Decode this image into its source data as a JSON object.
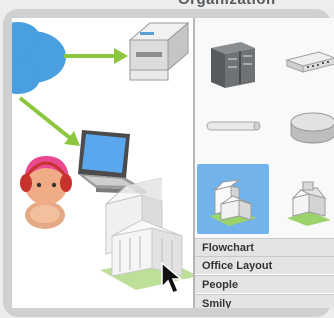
{
  "header": {
    "title": "Organization"
  },
  "palette": {
    "items": [
      {
        "name": "server-rack-icon",
        "selected": false
      },
      {
        "name": "network-switch-icon",
        "selected": false
      },
      {
        "name": "cable-bar-icon",
        "selected": false
      },
      {
        "name": "disk-storage-icon",
        "selected": false
      },
      {
        "name": "office-building-icon",
        "selected": true
      },
      {
        "name": "small-building-icon",
        "selected": false
      }
    ],
    "categories": [
      "Flowchart",
      "Office Layout",
      "People",
      "Smily"
    ]
  },
  "canvas": {
    "shapes": [
      "cloud-shape",
      "printer-shape",
      "laptop-shape",
      "person-shape",
      "building-shape"
    ],
    "accent_color": "#8cc63f",
    "cloud_color": "#4a9fe0"
  }
}
